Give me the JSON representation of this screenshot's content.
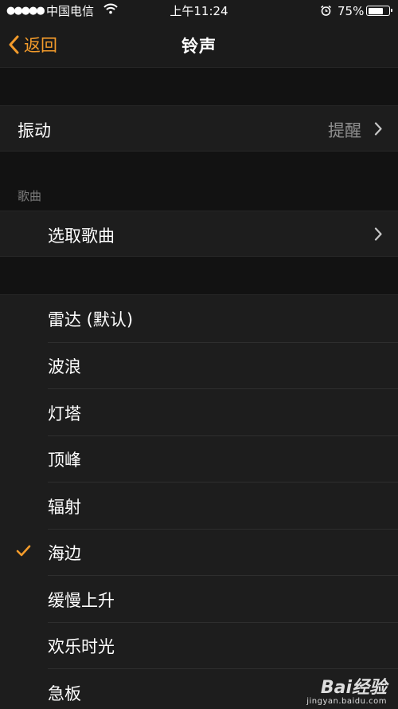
{
  "status_bar": {
    "signal": "●●●●●",
    "carrier": "中国电信",
    "time": "上午11:24",
    "battery": "75%",
    "battery_level": 0.75
  },
  "nav": {
    "back_label": "返回",
    "title": "铃声"
  },
  "vibration": {
    "label": "振动",
    "value": "提醒"
  },
  "songs": {
    "header": "歌曲",
    "pick_label": "选取歌曲"
  },
  "ringtones": [
    {
      "label": "雷达 (默认)",
      "selected": false
    },
    {
      "label": "波浪",
      "selected": false
    },
    {
      "label": "灯塔",
      "selected": false
    },
    {
      "label": "顶峰",
      "selected": false
    },
    {
      "label": "辐射",
      "selected": false
    },
    {
      "label": "海边",
      "selected": true
    },
    {
      "label": "缓慢上升",
      "selected": false
    },
    {
      "label": "欢乐时光",
      "selected": false
    },
    {
      "label": "急板",
      "selected": false
    }
  ],
  "watermark": {
    "logo": "Bai经验",
    "url": "jingyan.baidu.com"
  },
  "colors": {
    "accent": "#f39b2b",
    "background": "#121212",
    "cell": "#1d1d1d"
  }
}
